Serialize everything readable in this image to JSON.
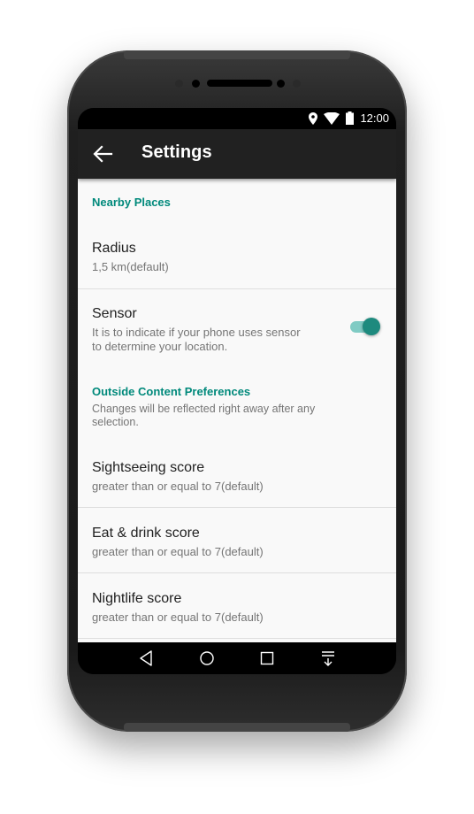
{
  "statusbar": {
    "time": "12:00",
    "icons": [
      "location-icon",
      "wifi-icon",
      "battery-icon"
    ]
  },
  "appbar": {
    "title": "Settings",
    "back_icon": "arrow-back-icon"
  },
  "sections": {
    "nearby": {
      "header": "Nearby Places",
      "radius_title": "Radius",
      "radius_summary": "1,5 km(default)",
      "sensor_title": "Sensor",
      "sensor_summary_line1": "It is to indicate if your phone uses sensor",
      "sensor_summary_line2": "to determine your location.",
      "sensor_enabled": true
    },
    "outside": {
      "header": "Outside Content Preferences",
      "summary_line1": "Changes will be reflected right away after any",
      "summary_line2": "selection.",
      "sightseeing_title": "Sightseeing score",
      "sightseeing_summary": "greater than or equal to 7(default)",
      "eatdrink_title": "Eat & drink score",
      "eatdrink_summary": "greater than or equal to 7(default)",
      "nightlife_title": "Nightlife score",
      "nightlife_summary": "greater than or equal to 7(default)"
    }
  },
  "colors": {
    "accent": "#00897b",
    "toolbar": "#212121",
    "background": "#f9f9f9",
    "switch_thumb": "#1e8a7e",
    "switch_track": "#80cbc4"
  },
  "navbar": {
    "icons": [
      "back-triangle-icon",
      "home-circle-icon",
      "recents-square-icon",
      "notification-pulldown-icon"
    ]
  }
}
